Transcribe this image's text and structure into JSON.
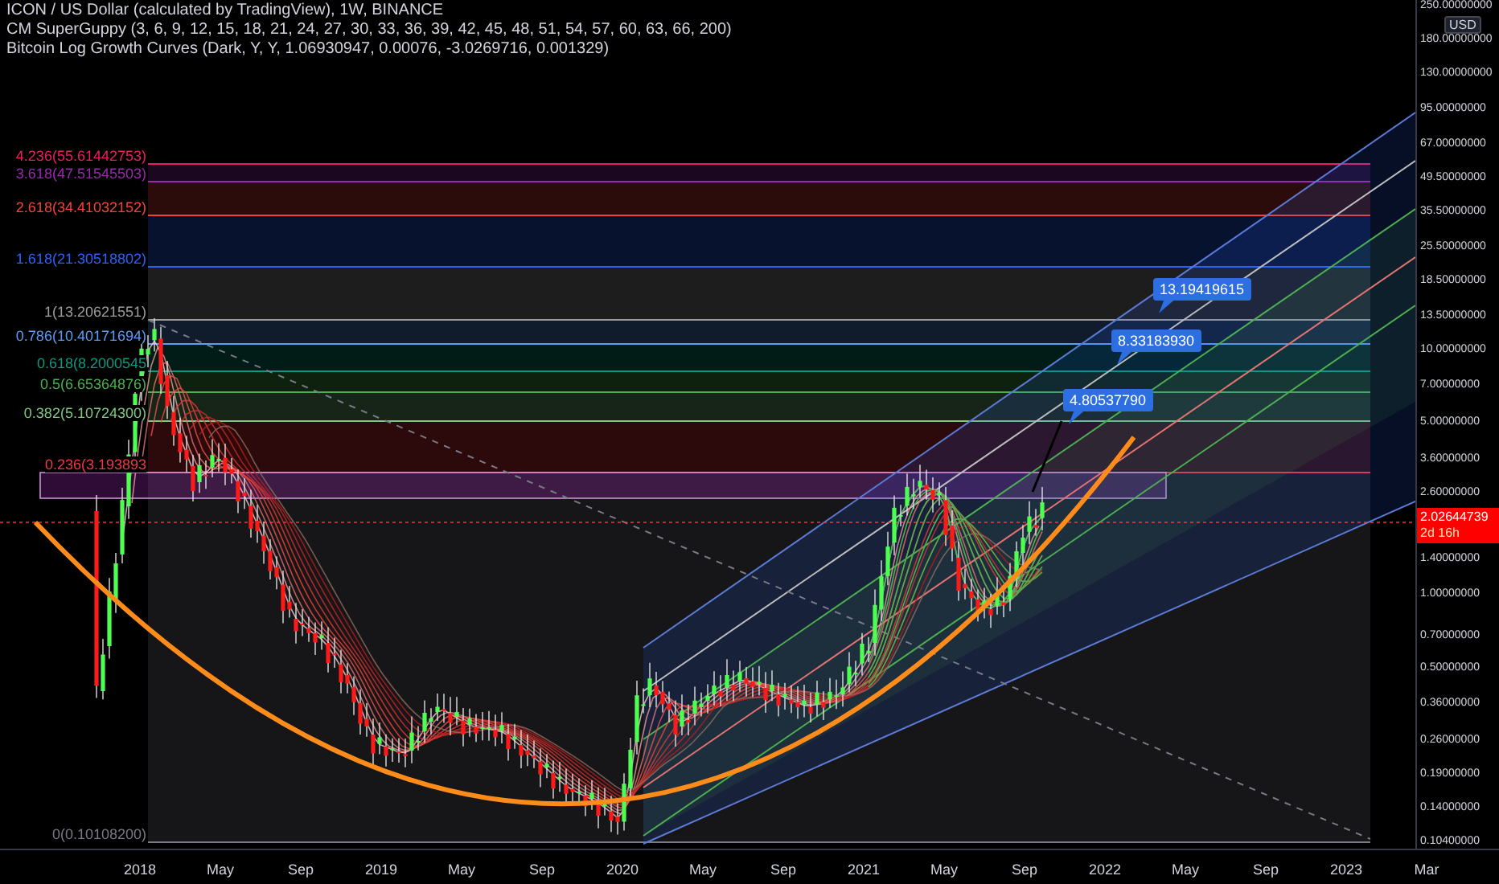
{
  "chart_title": "ICON / US Dollar (calculated by TradingView), 1W, BINANCE",
  "indicators": [
    "CM SuperGuppy (3, 6, 9, 12, 15, 18, 21, 24, 27, 30, 33, 36, 39, 42, 45, 48, 51, 54, 57, 60, 63, 66, 200)",
    "Bitcoin Log Growth Curves (Dark, Y, Y, 1.06930947, 0.00076, -3.0269716, 0.001329)"
  ],
  "fib_levels": [
    {
      "label": "4.236(55.61442753)",
      "color": "#e91e63"
    },
    {
      "label": "3.618(47.51545503)",
      "color": "#9c27b0"
    },
    {
      "label": "2.618(34.41032152)",
      "color": "#f44336"
    },
    {
      "label": "1.618(21.30518802)",
      "color": "#2962ff"
    },
    {
      "label": "1(13.20621551)",
      "color": "#9e9e9e"
    },
    {
      "label": "0.786(10.40171694)",
      "color": "#5b9cf6"
    },
    {
      "label": "0.618(8.2000545",
      "color": "#089981"
    },
    {
      "label": "0.5(6.65364876)",
      "color": "#4caf50"
    },
    {
      "label": "0.382(5.10724300)",
      "color": "#81c784"
    },
    {
      "label": "0.236(3.193893",
      "color": "#f23645"
    },
    {
      "label": "0(0.10108200)",
      "color": "#787b86"
    }
  ],
  "callouts": [
    {
      "text": "13.19419615"
    },
    {
      "text": "8.33183930"
    },
    {
      "text": "4.80537790"
    }
  ],
  "price_axis": {
    "unit": "USD",
    "ticks": [
      "250.00000000",
      "180.00000000",
      "130.00000000",
      "95.00000000",
      "67.00000000",
      "49.50000000",
      "35.50000000",
      "25.50000000",
      "18.50000000",
      "13.50000000",
      "10.00000000",
      "7.00000000",
      "5.00000000",
      "3.60000000",
      "2.60000000",
      "1.40000000",
      "1.00000000",
      "0.70000000",
      "0.50000000",
      "0.36000000",
      "0.26000000",
      "0.19000000",
      "0.14000000",
      "0.10400000"
    ]
  },
  "current_price": {
    "value": "2.02644739",
    "countdown": "2d 16h"
  },
  "time_axis": {
    "ticks": [
      "2018",
      "May",
      "Sep",
      "2019",
      "May",
      "Sep",
      "2020",
      "May",
      "Sep",
      "2021",
      "May",
      "Sep",
      "2022",
      "May",
      "Sep",
      "2023",
      "Mar"
    ]
  }
}
